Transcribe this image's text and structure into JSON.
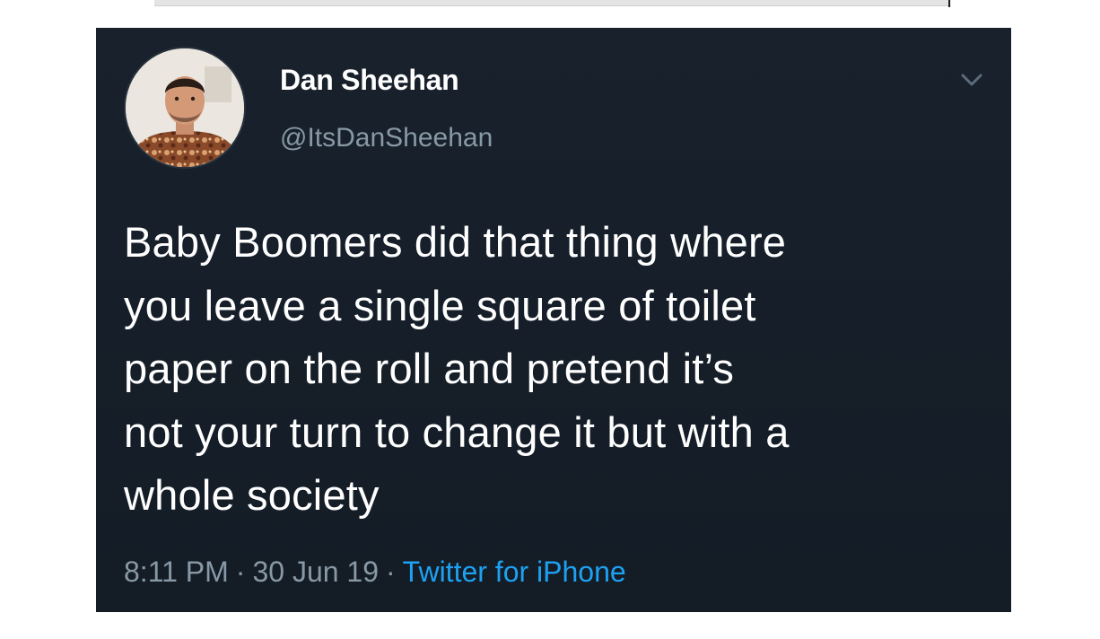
{
  "tweet": {
    "display_name": "Dan Sheehan",
    "handle": "@ItsDanSheehan",
    "text_lines": [
      "Baby Boomers did that thing where",
      "you leave a single square of toilet",
      "paper on the roll and pretend it’s",
      "not your turn to change it but with a",
      "whole society"
    ],
    "time": "8:11 PM",
    "separator": "·",
    "date": "30 Jun 19",
    "source": "Twitter for iPhone",
    "menu_icon": "chevron-down-icon",
    "avatar_icon": "user-photo-avatar"
  },
  "colors": {
    "background": "#15202b",
    "text": "#ffffff",
    "secondary": "#8899a6",
    "link": "#1da1f2"
  }
}
